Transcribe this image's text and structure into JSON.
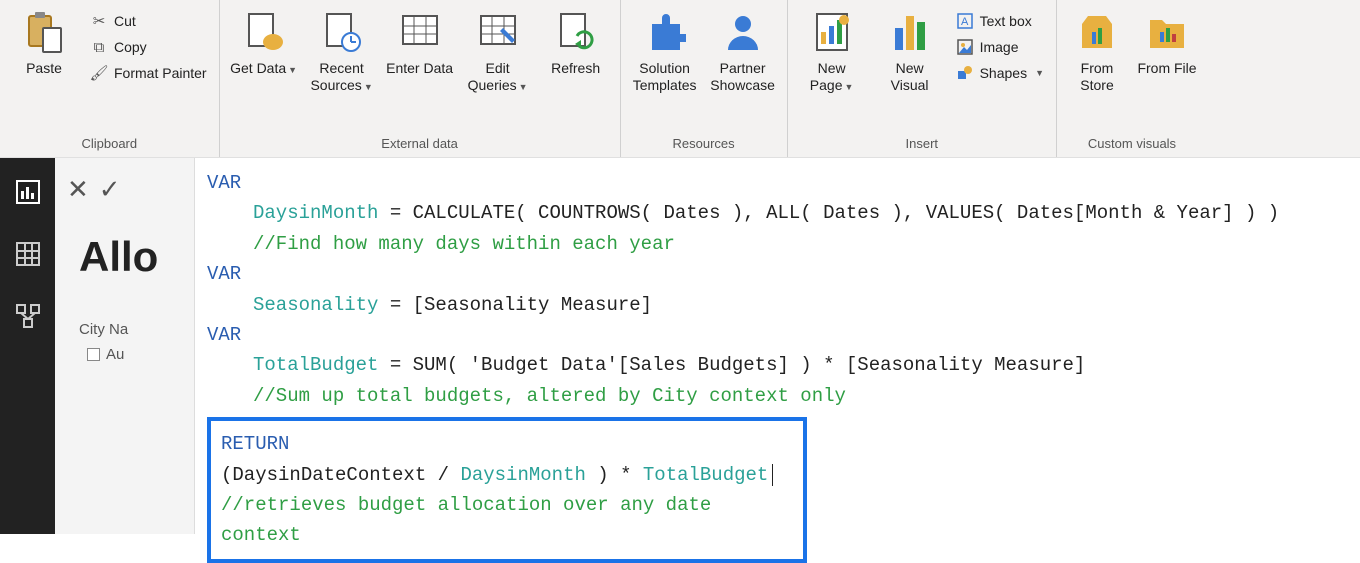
{
  "ribbon": {
    "clipboard": {
      "title": "Clipboard",
      "paste": "Paste",
      "cut": "Cut",
      "copy": "Copy",
      "format_painter": "Format Painter"
    },
    "external_data": {
      "title": "External data",
      "get_data": "Get Data",
      "recent_sources": "Recent Sources",
      "enter_data": "Enter Data",
      "edit_queries": "Edit Queries",
      "refresh": "Refresh"
    },
    "resources": {
      "title": "Resources",
      "solution_templates": "Solution Templates",
      "partner_showcase": "Partner Showcase"
    },
    "insert": {
      "title": "Insert",
      "new_page": "New Page",
      "new_visual": "New Visual",
      "text_box": "Text box",
      "image": "Image",
      "shapes": "Shapes"
    },
    "custom_visuals": {
      "title": "Custom visuals",
      "from_store": "From Store",
      "from_file": "From File"
    }
  },
  "page": {
    "title_truncated": "Allo",
    "filter_label": "City Na",
    "filter_items": [
      "Au"
    ]
  },
  "dax": {
    "line1_var": "VAR",
    "line2": {
      "id": "DaysinMonth",
      "text": " = CALCULATE( COUNTROWS( Dates ), ALL( Dates ), VALUES( Dates[Month & Year] ) )"
    },
    "line3_comment": "//Find how many days within each year",
    "line4_var": "VAR",
    "line5": {
      "id": "Seasonality",
      "text": " = [Seasonality Measure]"
    },
    "line6_var": "VAR",
    "line7": {
      "id": "TotalBudget",
      "text1": " = SUM( 'Budget Data'[Sales Budgets] ) * [Seasonality Measure]"
    },
    "line8_comment": "//Sum up total budgets, altered by City context only",
    "line9_return": "RETURN",
    "line10": {
      "a": "(DaysinDateContext",
      "b": " / ",
      "c": "DaysinMonth",
      "d": " ) * ",
      "e": "TotalBudget"
    },
    "line11_comment": "//retrieves budget allocation over any date context"
  }
}
